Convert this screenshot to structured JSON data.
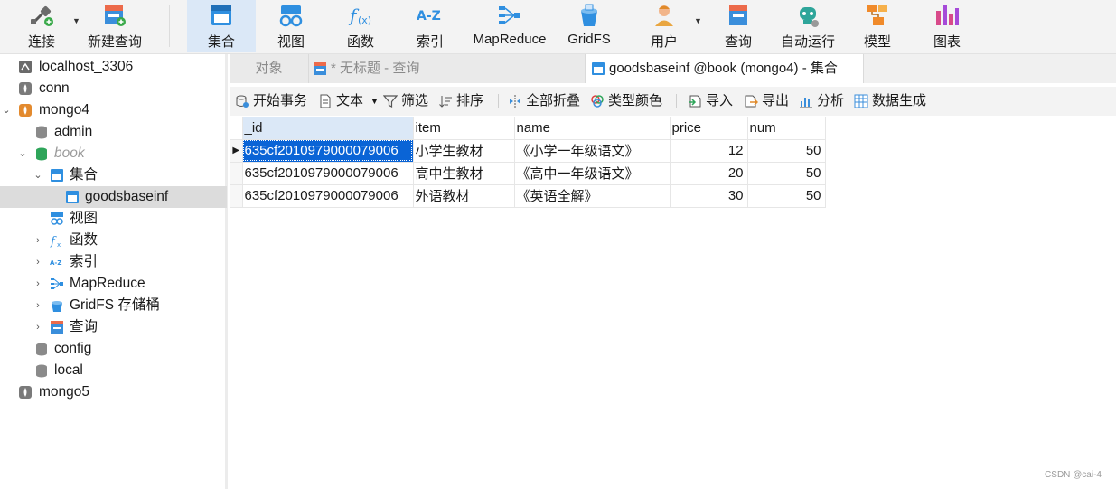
{
  "toolbar": {
    "connect": "连接",
    "new_query": "新建查询",
    "collection": "集合",
    "view": "视图",
    "function": "函数",
    "index": "索引",
    "mapreduce": "MapReduce",
    "gridfs": "GridFS",
    "user": "用户",
    "query": "查询",
    "auto_run": "自动运行",
    "model": "模型",
    "chart": "图表"
  },
  "sidebar": {
    "items": [
      {
        "label": "localhost_3306"
      },
      {
        "label": "conn"
      },
      {
        "label": "mongo4"
      },
      {
        "label": "admin"
      },
      {
        "label": "book"
      },
      {
        "label": "集合"
      },
      {
        "label": "goodsbaseinf"
      },
      {
        "label": "视图"
      },
      {
        "label": "函数"
      },
      {
        "label": "索引"
      },
      {
        "label": "MapReduce"
      },
      {
        "label": "GridFS 存储桶"
      },
      {
        "label": "查询"
      },
      {
        "label": "config"
      },
      {
        "label": "local"
      },
      {
        "label": "mongo5"
      }
    ]
  },
  "tabs": {
    "objects": "对象",
    "untitled": "* 无标题 - 查询",
    "active": "goodsbaseinf @book (mongo4) - 集合"
  },
  "subtoolbar": {
    "begin_tx": "开始事务",
    "text": "文本",
    "filter": "筛选",
    "sort": "排序",
    "collapse_all": "全部折叠",
    "type_color": "类型颜色",
    "import": "导入",
    "export": "导出",
    "analyze": "分析",
    "data_gen": "数据生成"
  },
  "grid": {
    "columns": [
      "_id",
      "item",
      "name",
      "price",
      "num"
    ],
    "rows": [
      [
        "635cf2010979000079006",
        "小学生教材",
        "《小学一年级语文》",
        "12",
        "50"
      ],
      [
        "635cf2010979000079006",
        "高中生教材",
        "《高中一年级语文》",
        "20",
        "50"
      ],
      [
        "635cf2010979000079006",
        "外语教材",
        "《英语全解》",
        "30",
        "50"
      ]
    ]
  },
  "watermark": "CSDN @cai-4",
  "colors": {
    "accent": "#0a64d6",
    "active_tool": "#dbe8f7",
    "toolbar_bg": "#f3f3f3"
  }
}
